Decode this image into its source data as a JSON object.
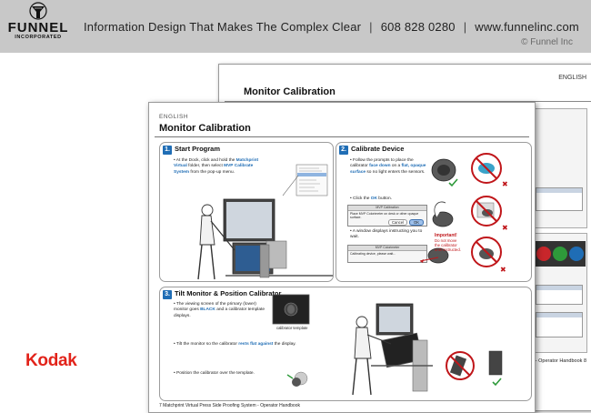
{
  "header": {
    "logo_name": "FUNNEL",
    "logo_sub": "INCORPORATED",
    "tagline": "Information Design That Makes The Complex Clear",
    "phone": "608 828 0280",
    "website": "www.funnelinc.com",
    "copyright": "© Funnel Inc"
  },
  "brand": "Kodak",
  "back_sheet": {
    "title": "Monitor Calibration",
    "language": "ENGLISH",
    "footer": "stem - Operator Handbook  8"
  },
  "front_sheet": {
    "language": "ENGLISH",
    "title": "Monitor Calibration",
    "footer": "7  Matchprint Virtual Press Side Proofing System - Operator Handbook",
    "steps": [
      {
        "number": "1.",
        "title": "Start Program",
        "text": {
          "pre": "• At the Dock, click and hold the ",
          "bold1": "Matchprint Virtual",
          "mid": " folder, then select ",
          "bold2": "MVP Calibrate System",
          "post": " from the pop-up menu."
        }
      },
      {
        "number": "2.",
        "title": "Calibrate Device",
        "bullets": {
          "b1_pre": "• Follow the prompts to place the calibrator ",
          "b1_bold1": "face down",
          "b1_mid": " on a ",
          "b1_bold2": "flat, opaque surface",
          "b1_post": " so no light enters the sensors.",
          "b2_pre": "• Click the ",
          "b2_bold": "OK",
          "b2_post": " button.",
          "b3": "• A window displays instructing you to wait."
        },
        "dialog1": {
          "title": "MVP Calibration",
          "message": "Place MVP Colorimeter on desk or other opaque surface.",
          "cancel": "Cancel",
          "ok": "OK"
        },
        "dialog2": {
          "title": "MVP Colorimeter",
          "message": "Calibrating device, please wait..."
        },
        "important": {
          "heading": "Important!",
          "line1": "Do not move",
          "line2": "the calibrator",
          "line3": "until instructed."
        }
      },
      {
        "number": "3.",
        "title": "Tilt Monitor & Position Calibrator",
        "text": {
          "b1_pre": "• The viewing screen of the primary (lower) monitor goes ",
          "b1_bold": "BLACK",
          "b1_post": " and a calibrator template displays.",
          "template_caption": "calibrator template",
          "b2_pre": "• Tilt the monitor so the calibrator ",
          "b2_bold": "rests flat against",
          "b2_post": " the display.",
          "b3": "• Position the calibrator over the template."
        }
      }
    ]
  },
  "colors": {
    "accent_blue": "#1f6db5",
    "warning_red": "#c0161a",
    "check_green": "#2e9a3a",
    "kodak_red": "#e2231a",
    "banner_gray": "#c8c8c8"
  }
}
